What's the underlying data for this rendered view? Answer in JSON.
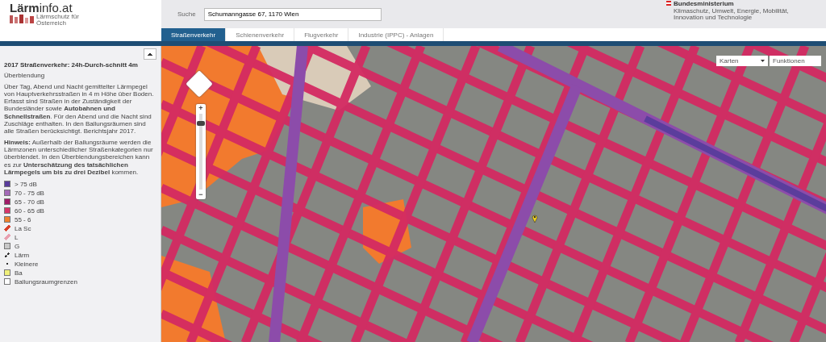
{
  "header": {
    "logo_title": "**Lärm**info.at",
    "logo_subtitle": "Lärmschutz für Österreich",
    "search": {
      "label": "Suche",
      "value": "Schumanngasse 67, 1170 Wien"
    },
    "ministry": {
      "name": "Bundesministerium",
      "subtitle": "Klimaschutz, Umwelt, Energie, Mobilität, Innovation und Technologie"
    }
  },
  "tabs": [
    {
      "label": "Straßenverkehr",
      "selected": true
    },
    {
      "label": "Schienenverkehr",
      "selected": false
    },
    {
      "label": "Flugverkehr",
      "selected": false
    },
    {
      "label": "Industrie (IPPC) - Anlagen",
      "selected": false
    }
  ],
  "sidebar": {
    "title": "2017 Straßenverkehr: 24h-Durch-schnitt 4m",
    "subtitle": "Überblendung",
    "paragraphs": [
      "Über Tag, Abend und Nacht gemittelter Lärmpegel von Hauptverkehrsstraßen in 4 m Höhe über Boden. Erfasst sind Straßen in der Zuständigkeit der Bundesländer sowie **Autobahnen und Schnellstraßen**. Für den Abend und die Nacht sind Zuschläge enthalten. In den Ballungsräumen sind alle Straßen berücksichtigt. Berichtsjahr 2017.",
      "**Hinweis:** Außerhalb der Ballungsräume werden die Lärmzonen unterschiedlicher Straßenkategorien nur überblendet. In den Überblendungsbereichen kann es zur **Unterschätzung des tatsächlichen Lärmpegels um bis zu drei Dezibel** kommen."
    ],
    "legend": [
      {
        "kind": "swatch",
        "label": "> 75 dB",
        "color": "#5a3c9c"
      },
      {
        "kind": "swatch",
        "label": "70 - 75 dB",
        "color": "#a46ab8"
      },
      {
        "kind": "swatch",
        "label": "65 - 70 dB",
        "color": "#a01c68"
      },
      {
        "kind": "swatch",
        "label": "60 - 65 dB",
        "color": "#d8356a"
      },
      {
        "kind": "swatch",
        "label": "55 - 6",
        "color": "#f0822e"
      },
      {
        "kind": "line",
        "label": "La Sc",
        "color": "#d8402a"
      },
      {
        "kind": "line",
        "label": "L",
        "color": "#e8a0b0"
      },
      {
        "kind": "box",
        "label": "G",
        "color": "#c8c8c8"
      },
      {
        "kind": "dashed",
        "label": "Lärm",
        "color": "#303030"
      },
      {
        "kind": "dot",
        "label": "Kleinere",
        "color": "#303030"
      },
      {
        "kind": "box",
        "label": "Ba",
        "color": "#f0f07a"
      },
      {
        "kind": "box",
        "label": "Ballungsraumgrenzen",
        "color": "#ffffff"
      }
    ]
  },
  "map": {
    "zoom_in": "+",
    "zoom_out": "−",
    "zoom_slider": {
      "level": 0.9
    },
    "dropdowns": [
      "Karten",
      "Funktionen"
    ]
  }
}
